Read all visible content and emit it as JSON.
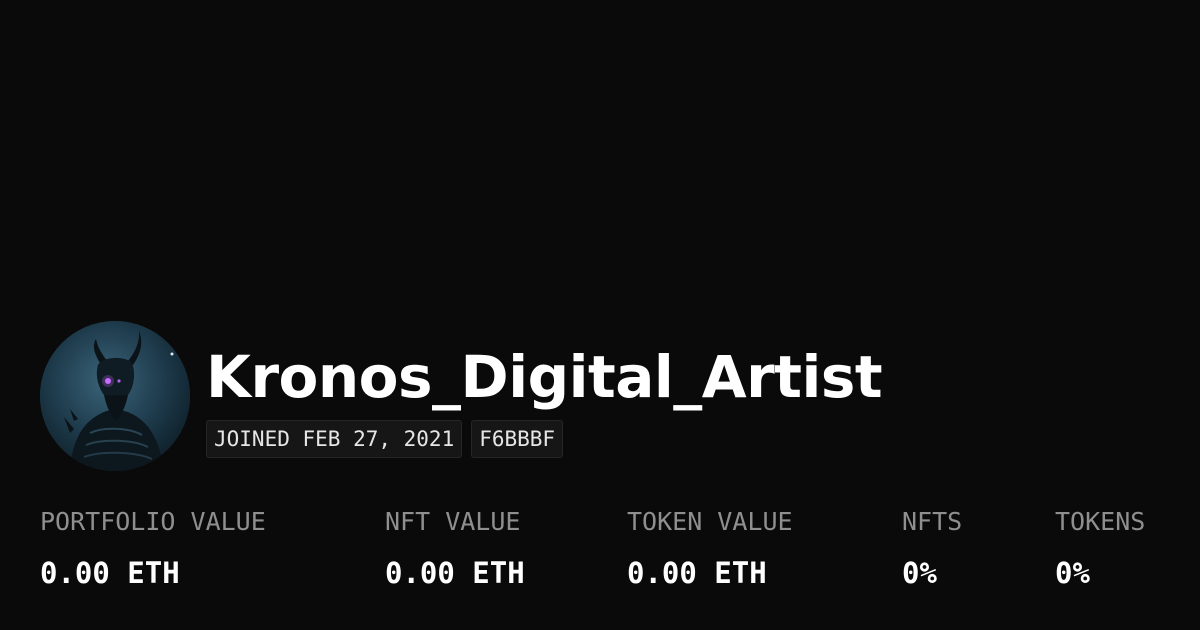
{
  "profile": {
    "username": "Kronos_Digital_Artist",
    "joined": "JOINED FEB 27, 2021",
    "address_tag": "F6BBBF"
  },
  "stats": [
    {
      "label": "PORTFOLIO VALUE",
      "value": "0.00 ETH"
    },
    {
      "label": "NFT VALUE",
      "value": "0.00 ETH"
    },
    {
      "label": "TOKEN VALUE",
      "value": "0.00 ETH"
    },
    {
      "label": "NFTS",
      "value": "0%"
    },
    {
      "label": "TOKENS",
      "value": "0%"
    }
  ],
  "colors": {
    "background": "#0a0a0a",
    "text": "#ffffff",
    "label": "#8f8f8f",
    "badge_background": "#161616"
  },
  "icons": {
    "avatar": "demon-portrait-avatar"
  }
}
